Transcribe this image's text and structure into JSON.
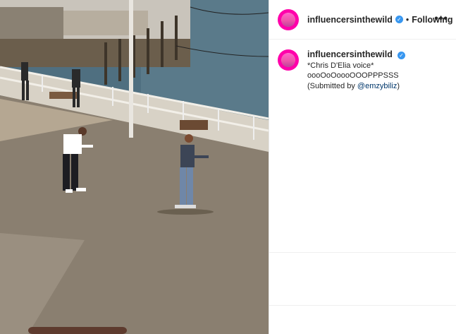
{
  "post": {
    "username": "influencersinthewild",
    "verified_icon": "verified-badge-icon",
    "separator": "•",
    "follow_state": "Following",
    "more_icon": "more-options-icon",
    "more_glyph": "•••"
  },
  "caption": {
    "username": "influencersinthewild",
    "line1": "*Chris D'Elia voice*",
    "line2": "oooOoOoooOOOPPPSSS",
    "line3_prefix": "(Submitted by ",
    "mention": "@emzybiliz",
    "line3_suffix": ")"
  },
  "media": {
    "type": "video-frame",
    "description_icon": "video-frame"
  },
  "colors": {
    "verified_blue": "#3897f0",
    "link_blue": "#00376b",
    "avatar_pink": "#ee55aa"
  }
}
